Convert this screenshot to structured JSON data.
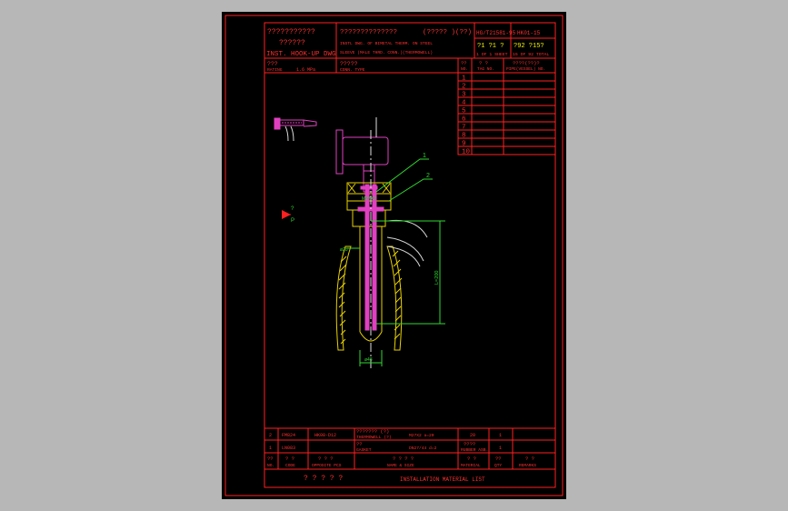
{
  "title_block": {
    "cn_title": "???????????",
    "cn_sub": "??????",
    "en_title": "INST. HOOK-UP DWG",
    "drawing_cn": "??????????????",
    "drawing_en_1": "INSTL DWG. OF BIMETAL THERM. ON STEEL",
    "drawing_en_2": "SLEEVE (MALE THRD. CONN.)(THERMOWELL)",
    "std_cn": "(????? )(??)",
    "std_no": "HG/T21581-95",
    "dwg_no": "HK01-15",
    "sheet_cn": "?1 ?1 ?",
    "sheet_en": "1 OF 1 SHEET",
    "total_cn": "?92 ?15?",
    "total_en": "15 OF 92 TOTAL"
  },
  "rating": {
    "cn": "???",
    "en": "RATING",
    "value": "1.6 MPa"
  },
  "conn": {
    "cn": "?????",
    "en": "CONN. TYPE"
  },
  "tag_table": {
    "headers": [
      {
        "cn": "??",
        "en": "NO."
      },
      {
        "cn": "?  ?",
        "en": "TAG NO."
      },
      {
        "cn": "????(??)?",
        "en": "PIPE(VESSEL) NO."
      }
    ],
    "rows": [
      "1",
      "2",
      "3",
      "4",
      "5",
      "6",
      "7",
      "8",
      "9",
      "10"
    ]
  },
  "drawing": {
    "leader_1": "1",
    "leader_2": "2",
    "dim_thread": "M27X2",
    "dim_od": "ø28",
    "dim_insert": "L=200",
    "dim_pipe": "ø48",
    "flow_cn": "?",
    "flow_en": "P"
  },
  "material_list": {
    "rows": [
      {
        "no": "2",
        "code": "FM824",
        "code2": "HK08-D12",
        "name_cn": "???????  (?)",
        "name_en": "THERMOWELL (?)",
        "spec": "M27X2  a=20",
        "material": "20",
        "qty": "1",
        "remarks": ""
      },
      {
        "no": "1",
        "code": "LN083",
        "code2": "",
        "name_cn": "??",
        "name_en": "GASKET",
        "spec": "DN27/44  d=2",
        "material_cn": "????",
        "material": "RUBBER ASB.",
        "qty": "1",
        "remarks": ""
      }
    ],
    "headers": [
      {
        "cn": "??",
        "en": "NO."
      },
      {
        "cn": "? ?",
        "en": "CODE"
      },
      {
        "cn": "?  ? ?",
        "en": "OPPOSITE PCS"
      },
      {
        "cn": "?  ? ? ?",
        "en": "NAME & SIZE"
      },
      {
        "cn": "?  ?",
        "en": "MATERIAL"
      },
      {
        "cn": "??",
        "en": "QTY"
      },
      {
        "cn": "?  ?",
        "en": "REMARKS"
      }
    ],
    "footer_cn": "? ? ? ? ?",
    "footer_en": "INSTALLATION MATERIAL LIST"
  }
}
